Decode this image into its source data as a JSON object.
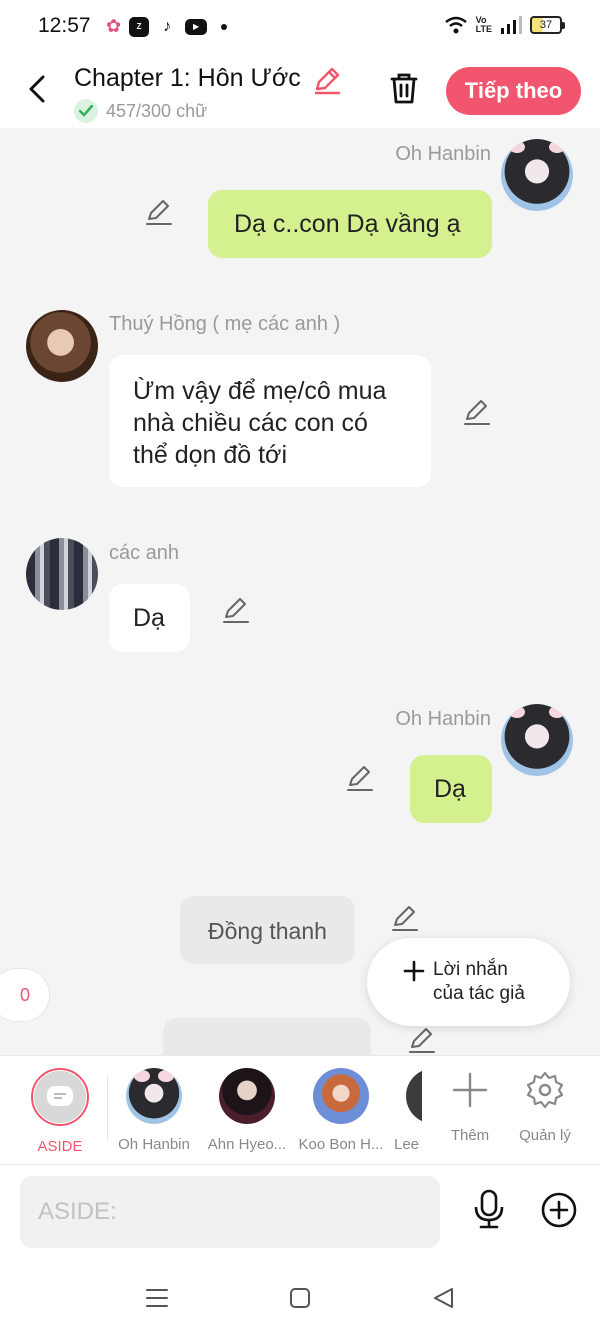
{
  "status_bar": {
    "time": "12:57",
    "apps": [
      "zalo",
      "tiktok",
      "youtube"
    ],
    "battery": "37"
  },
  "header": {
    "title": "Chapter 1: Hôn Ước",
    "word_count": "457/300 chữ",
    "next_label": "Tiếp theo"
  },
  "messages": [
    {
      "sender": "Oh Hanbin",
      "text": "Dạ c..con Dạ vầng ạ",
      "side": "right",
      "style": "green"
    },
    {
      "sender": "Thuý Hồng ( mẹ các anh )",
      "text": "Ừm vậy để mẹ/cô mua nhà chiều các con có thể dọn đồ tới",
      "side": "left",
      "style": "white"
    },
    {
      "sender": "các anh",
      "text": "Dạ",
      "side": "left",
      "style": "white"
    },
    {
      "sender": "Oh Hanbin",
      "text": "Dạ",
      "side": "right",
      "style": "green"
    },
    {
      "sender": "",
      "text": "Đồng thanh",
      "side": "center",
      "style": "gray"
    }
  ],
  "author_note": {
    "label": "Lời nhắn của tác giả"
  },
  "count_badge": "0",
  "characters": [
    {
      "name": "ASIDE",
      "active": true
    },
    {
      "name": "Oh Hanbin"
    },
    {
      "name": "Ahn Hyeo..."
    },
    {
      "name": "Koo Bon H..."
    },
    {
      "name": "Lee"
    }
  ],
  "tools": {
    "add_label": "Thêm",
    "manage_label": "Quản lý"
  },
  "input": {
    "placeholder": "ASIDE:",
    "value": ""
  },
  "colors": {
    "accent": "#f2566f",
    "green_bubble": "#d5f08e",
    "background": "#f4f4f4"
  }
}
